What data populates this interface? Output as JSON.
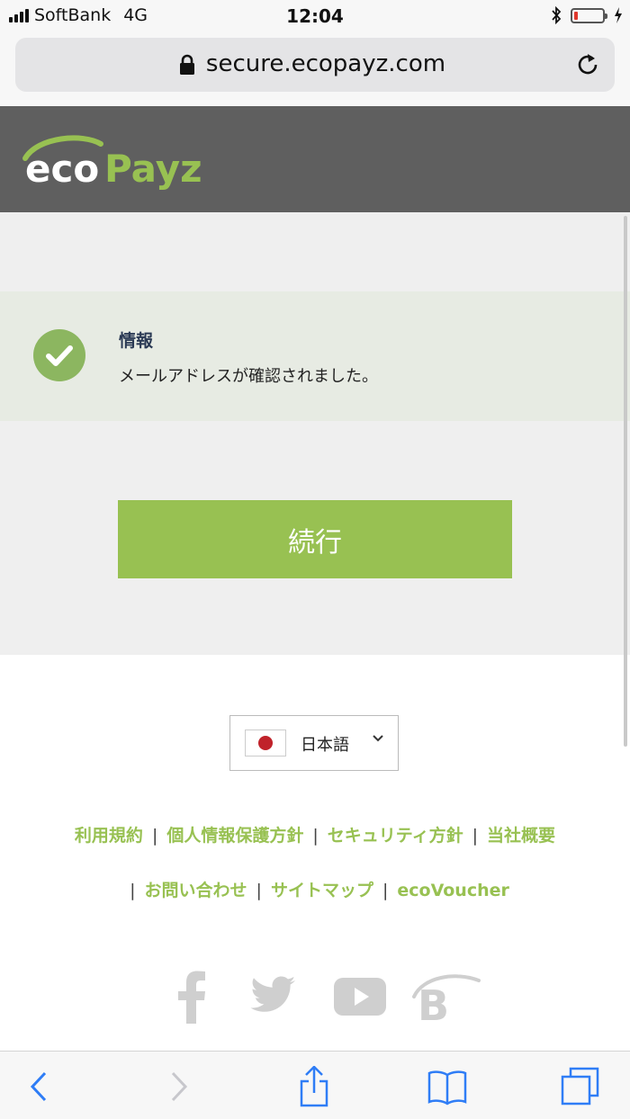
{
  "status_bar": {
    "carrier": "SoftBank",
    "network": "4G",
    "time": "12:04",
    "battery_level": 0.12
  },
  "browser": {
    "url": "secure.ecopayz.com"
  },
  "header": {
    "logo_text_light": "eco",
    "logo_text_accent": "Payz"
  },
  "notice": {
    "title": "情報",
    "message": "メールアドレスが確認されました。"
  },
  "continue_label": "続行",
  "language": {
    "selected": "日本語"
  },
  "footer_links_row1": [
    "利用規約",
    "個人情報保護方針",
    "セキュリティ方針",
    "当社概要"
  ],
  "footer_links_row2": [
    "お問い合わせ",
    "サイトマップ",
    "ecoVoucher"
  ],
  "social_icons": [
    "facebook-icon",
    "twitter-icon",
    "youtube-icon",
    "blog-icon"
  ],
  "toolbar_icons": [
    "back-icon",
    "forward-icon",
    "share-icon",
    "bookmarks-icon",
    "tabs-icon"
  ],
  "colors": {
    "brand_green": "#98c152",
    "header_grey": "#5f5f5f",
    "notice_bg": "#e7ebe3"
  }
}
